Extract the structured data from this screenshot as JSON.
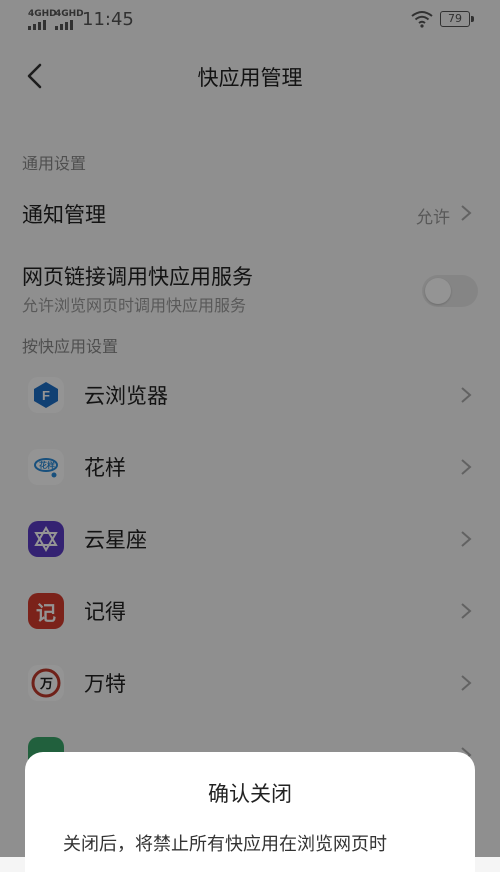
{
  "status": {
    "signal1": "4GHD",
    "signal2": "4GHD",
    "time": "11:45",
    "battery": "79"
  },
  "header": {
    "title": "快应用管理"
  },
  "general": {
    "section_label": "通用设置",
    "notification_label": "通知管理",
    "notification_value": "允许",
    "weblink_label": "网页链接调用快应用服务",
    "weblink_desc": "允许浏览网页时调用快应用服务"
  },
  "per_app": {
    "section_label": "按快应用设置",
    "apps": [
      {
        "name": "云浏览器",
        "icon": "cloud-browser-icon",
        "color": "#1c6fc6"
      },
      {
        "name": "花样",
        "icon": "huayang-icon",
        "color": "#2a8bd8"
      },
      {
        "name": "云星座",
        "icon": "star-of-david-icon",
        "color": "#5a3bc4"
      },
      {
        "name": "记得",
        "icon": "jide-icon",
        "color": "#d43b2e"
      },
      {
        "name": "万特",
        "icon": "wante-icon",
        "color": "#c0392b"
      }
    ]
  },
  "dialog": {
    "title": "确认关闭",
    "message": "关闭后，将禁止所有快应用在浏览网页时"
  }
}
